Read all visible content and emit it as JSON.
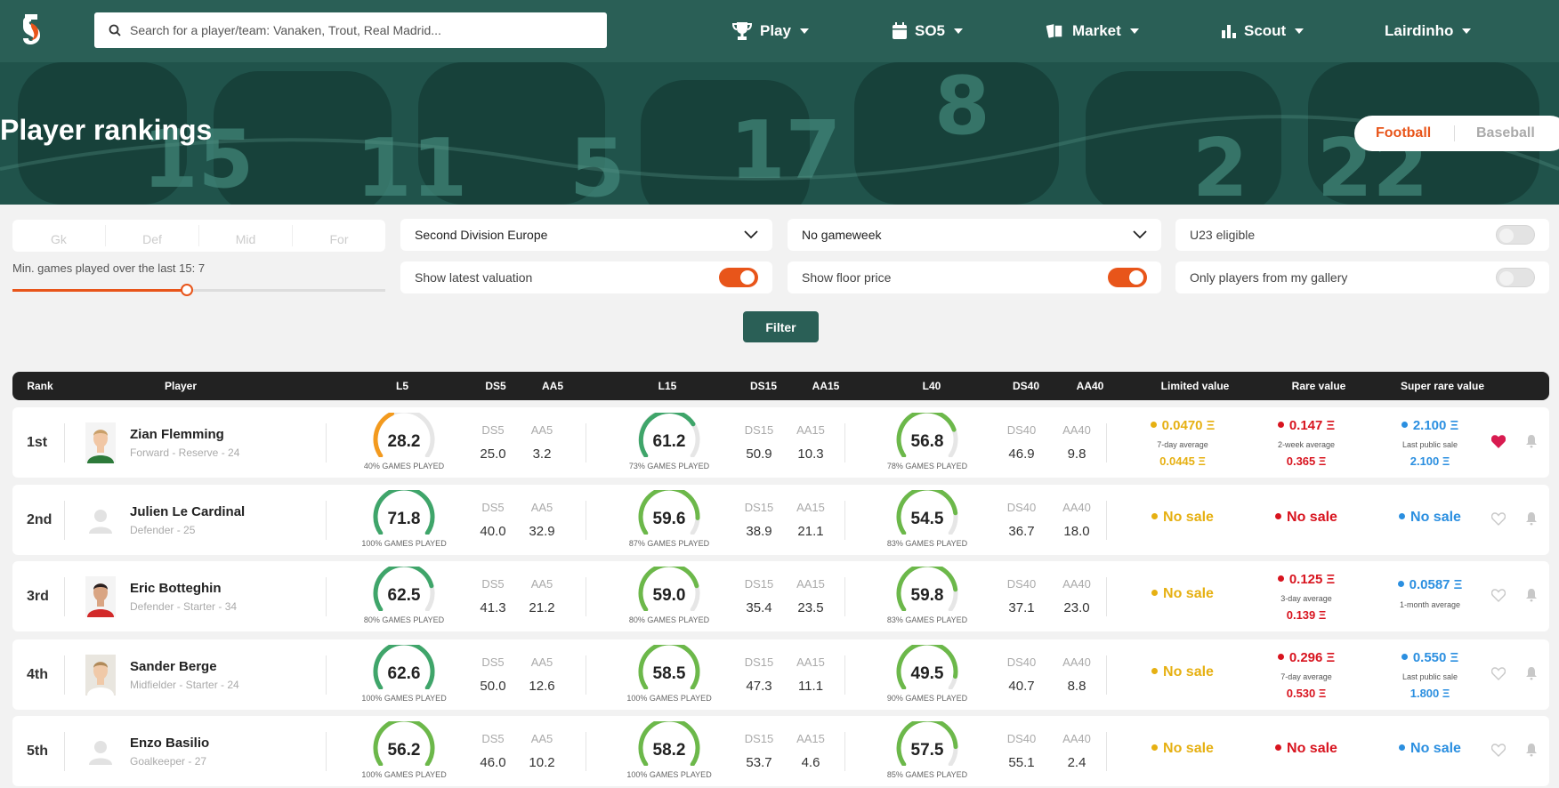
{
  "header": {
    "search_placeholder": "Search for a player/team: Vanaken, Trout, Real Madrid...",
    "nav": [
      {
        "label": "Play",
        "icon": "trophy-icon"
      },
      {
        "label": "SO5",
        "icon": "calendar-icon"
      },
      {
        "label": "Market",
        "icon": "cards-icon"
      },
      {
        "label": "Scout",
        "icon": "bar-chart-icon"
      },
      {
        "label": "Lairdinho",
        "icon": ""
      }
    ]
  },
  "hero": {
    "title": "Player rankings",
    "sport_tabs": [
      "Football",
      "Baseball"
    ],
    "active_sport": "Football"
  },
  "filters": {
    "positions": [
      "Gk",
      "Def",
      "Mid",
      "For"
    ],
    "min_games_label": "Min. games played over the last 15: 7",
    "min_games_value": 7,
    "min_games_max": 15,
    "league": "Second Division Europe",
    "gameweek": "No gameweek",
    "u23_label": "U23 eligible",
    "u23_on": false,
    "valuation_label": "Show latest valuation",
    "valuation_on": true,
    "floor_label": "Show floor price",
    "floor_on": true,
    "gallery_label": "Only players from my gallery",
    "gallery_on": false,
    "filter_button": "Filter"
  },
  "table": {
    "headers": [
      "Rank",
      "Player",
      "L5",
      "DS5",
      "AA5",
      "L15",
      "DS15",
      "AA15",
      "L40",
      "DS40",
      "AA40",
      "Limited value",
      "Rare value",
      "Super rare value"
    ],
    "rows": [
      {
        "rank": "1st",
        "name": "Zian Flemming",
        "meta": "Forward - Reserve - 24",
        "avatar": "photo",
        "l5": {
          "value": "28.2",
          "pct_label": "40% GAMES PLAYED",
          "pct": 40
        },
        "ds5": "25.0",
        "aa5": "3.2",
        "l15": {
          "value": "61.2",
          "pct_label": "73% GAMES PLAYED",
          "pct": 73
        },
        "ds15": "50.9",
        "aa15": "10.3",
        "l40": {
          "value": "56.8",
          "pct_label": "78% GAMES PLAYED",
          "pct": 78
        },
        "ds40": "46.9",
        "aa40": "9.8",
        "limited": {
          "main": "0.0470 Ξ",
          "sub": "7-day average",
          "sub2": "0.0445 Ξ"
        },
        "rare": {
          "main": "0.147 Ξ",
          "sub": "2-week average",
          "sub2": "0.365 Ξ"
        },
        "super": {
          "main": "2.100 Ξ",
          "sub": "Last public sale",
          "sub2": "2.100 Ξ"
        },
        "favorite": true
      },
      {
        "rank": "2nd",
        "name": "Julien Le Cardinal",
        "meta": "Defender - 25",
        "avatar": "placeholder",
        "l5": {
          "value": "71.8",
          "pct_label": "100% GAMES PLAYED",
          "pct": 100
        },
        "ds5": "40.0",
        "aa5": "32.9",
        "l15": {
          "value": "59.6",
          "pct_label": "87% GAMES PLAYED",
          "pct": 87
        },
        "ds15": "38.9",
        "aa15": "21.1",
        "l40": {
          "value": "54.5",
          "pct_label": "83% GAMES PLAYED",
          "pct": 83
        },
        "ds40": "36.7",
        "aa40": "18.0",
        "limited": {
          "main": "No sale",
          "sub": "",
          "sub2": ""
        },
        "rare": {
          "main": "No sale",
          "sub": "",
          "sub2": ""
        },
        "super": {
          "main": "No sale",
          "sub": "",
          "sub2": ""
        },
        "favorite": false
      },
      {
        "rank": "3rd",
        "name": "Eric Botteghin",
        "meta": "Defender - Starter - 34",
        "avatar": "photo",
        "l5": {
          "value": "62.5",
          "pct_label": "80% GAMES PLAYED",
          "pct": 80
        },
        "ds5": "41.3",
        "aa5": "21.2",
        "l15": {
          "value": "59.0",
          "pct_label": "80% GAMES PLAYED",
          "pct": 80
        },
        "ds15": "35.4",
        "aa15": "23.5",
        "l40": {
          "value": "59.8",
          "pct_label": "83% GAMES PLAYED",
          "pct": 83
        },
        "ds40": "37.1",
        "aa40": "23.0",
        "limited": {
          "main": "No sale",
          "sub": "",
          "sub2": ""
        },
        "rare": {
          "main": "0.125 Ξ",
          "sub": "3-day average",
          "sub2": "0.139 Ξ"
        },
        "super": {
          "main": "0.0587 Ξ",
          "sub": "1-month average",
          "sub2": ""
        },
        "favorite": false
      },
      {
        "rank": "4th",
        "name": "Sander Berge",
        "meta": "Midfielder - Starter - 24",
        "avatar": "photo",
        "l5": {
          "value": "62.6",
          "pct_label": "100% GAMES PLAYED",
          "pct": 100
        },
        "ds5": "50.0",
        "aa5": "12.6",
        "l15": {
          "value": "58.5",
          "pct_label": "100% GAMES PLAYED",
          "pct": 100
        },
        "ds15": "47.3",
        "aa15": "11.1",
        "l40": {
          "value": "49.5",
          "pct_label": "90% GAMES PLAYED",
          "pct": 90
        },
        "ds40": "40.7",
        "aa40": "8.8",
        "limited": {
          "main": "No sale",
          "sub": "",
          "sub2": ""
        },
        "rare": {
          "main": "0.296 Ξ",
          "sub": "7-day average",
          "sub2": "0.530 Ξ"
        },
        "super": {
          "main": "0.550 Ξ",
          "sub": "Last public sale",
          "sub2": "1.800 Ξ"
        },
        "favorite": false
      },
      {
        "rank": "5th",
        "name": "Enzo Basilio",
        "meta": "Goalkeeper - 27",
        "avatar": "placeholder",
        "l5": {
          "value": "56.2",
          "pct_label": "100% GAMES PLAYED",
          "pct": 100
        },
        "ds5": "46.0",
        "aa5": "10.2",
        "l15": {
          "value": "58.2",
          "pct_label": "100% GAMES PLAYED",
          "pct": 100
        },
        "ds15": "53.7",
        "aa15": "4.6",
        "l40": {
          "value": "57.5",
          "pct_label": "85% GAMES PLAYED",
          "pct": 85
        },
        "ds40": "55.1",
        "aa40": "2.4",
        "limited": {
          "main": "No sale",
          "sub": "",
          "sub2": ""
        },
        "rare": {
          "main": "No sale",
          "sub": "",
          "sub2": ""
        },
        "super": {
          "main": "No sale",
          "sub": "",
          "sub2": ""
        },
        "favorite": false
      }
    ]
  },
  "colors": {
    "brand": "#2a5f56",
    "accent": "#e8551a",
    "limited": "#e6b012",
    "rare": "#d8141f",
    "super_rare": "#2b8fe0",
    "heart": "#d81b50"
  }
}
